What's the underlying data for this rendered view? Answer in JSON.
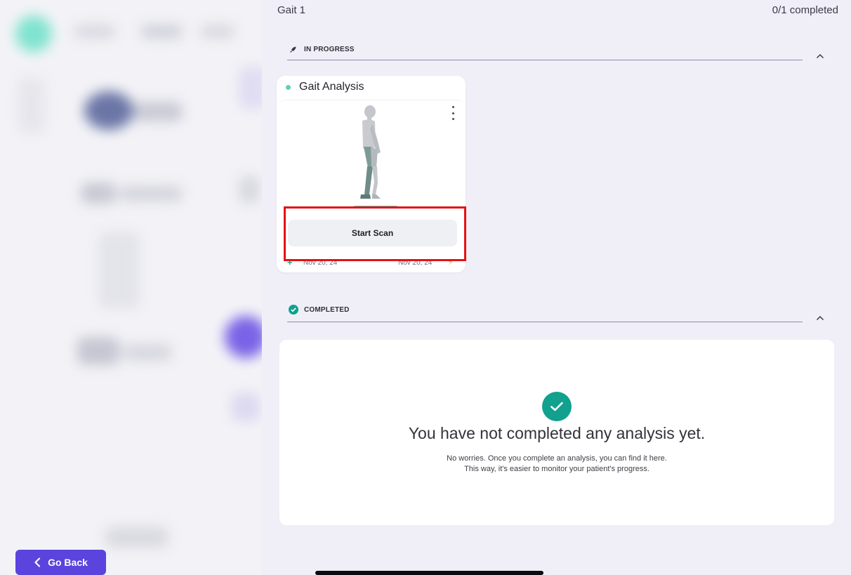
{
  "header": {
    "title": "Gait 1",
    "progress": "0/1 completed"
  },
  "sections": {
    "in_progress": {
      "label": "IN PROGRESS"
    },
    "completed": {
      "label": "COMPLETED"
    }
  },
  "card": {
    "title": "Gait Analysis",
    "start_button": "Start Scan",
    "date_created": "Nov 20, 24",
    "date_due": "Nov 20, 24",
    "status_color": "#5fd1b6"
  },
  "empty_state": {
    "title": "You have not completed any analysis yet.",
    "line1": "No worries. Once you complete an analysis, you can find it here.",
    "line2": "This way, it's easier to monitor your patient's progress."
  },
  "footer": {
    "go_back": "Go Back"
  },
  "colors": {
    "accent": "#5b43de",
    "teal": "#12a08f",
    "highlight": "#e31212"
  }
}
